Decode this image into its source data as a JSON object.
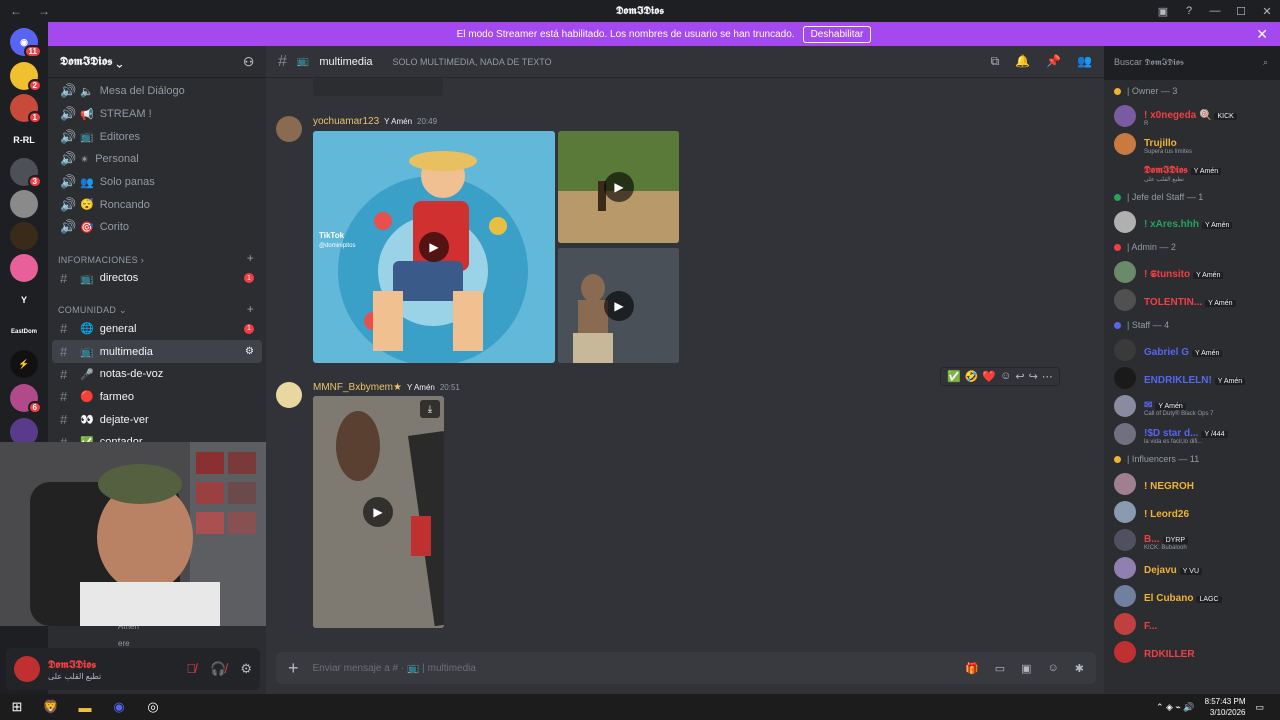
{
  "window": {
    "title": "𝕯𝖔𝖒𝕴𝕯𝖎𝖔𝖘",
    "back": "←",
    "forward": "→"
  },
  "streamer_bar": {
    "message": "El modo Streamer está habilitado. Los nombres de usuario se han truncado.",
    "button": "Deshabilitar",
    "close": "✕"
  },
  "guild_labels": {
    "rrl": "R-RL",
    "eastdom": "EastDom"
  },
  "server": {
    "name": "𝕯𝖔𝖒𝕴𝕯𝖎𝖔𝖘 ⌄",
    "add_user": "⚇"
  },
  "voice_channels": [
    {
      "icon": "🔈",
      "label": "Mesa del Diálogo"
    },
    {
      "icon": "📢",
      "label": "STREAM !"
    },
    {
      "icon": "📺",
      "label": "Editores"
    },
    {
      "icon": "✴",
      "label": "Personal"
    },
    {
      "icon": "👥",
      "label": "Solo panas"
    },
    {
      "icon": "😴",
      "label": "Roncando"
    },
    {
      "icon": "🎯",
      "label": "Corito"
    }
  ],
  "categories": {
    "informaciones": "INFORMACIONES ›",
    "comunidad": "COMUNIDAD ⌄"
  },
  "info_channels": [
    {
      "icon": "📺",
      "label": "directos",
      "unread": true
    }
  ],
  "community_channels": [
    {
      "icon": "🌐",
      "label": "general",
      "unread": true,
      "active": false
    },
    {
      "icon": "📺",
      "label": "multimedia",
      "unread": false,
      "active": true
    },
    {
      "icon": "🎤",
      "label": "notas-de-voz",
      "unread": false,
      "active": false
    },
    {
      "icon": "🔴",
      "label": "farmeo",
      "unread": false,
      "active": false
    },
    {
      "icon": "👀",
      "label": "dejate-ver",
      "unread": false,
      "active": false
    },
    {
      "icon": "✅",
      "label": "contador",
      "unread": false,
      "active": false
    }
  ],
  "voice_users": {
    "user1": "Amén",
    "user2": "ere"
  },
  "user_panel": {
    "name": "𝕯𝖔𝖒𝕴𝕯𝖎𝖔𝖘",
    "status": "تطبع القلب على"
  },
  "channel_header": {
    "name": "multimedia",
    "topic": "SOLO MULTIMEDIA, NADA DE TEXTO"
  },
  "search": {
    "placeholder": "Buscar 𝕯𝖔𝖒𝕴𝕯𝖎𝖔𝖘",
    "icon": "search-icon"
  },
  "messages": [
    {
      "author": "yochuamar123",
      "role": "Y Amén",
      "time": "20:49",
      "color": "#e8c36b",
      "media_text": "TikTok",
      "media_handle": "@dominipitos"
    },
    {
      "author": "MMNF_Bxbymem★",
      "role": "Y Amén",
      "time": "20:51",
      "color": "#e8c36b"
    }
  ],
  "reactions": [
    "✅",
    "🤣",
    "❤️",
    "☺",
    "↩",
    "↪",
    "⋯"
  ],
  "composer": {
    "placeholder": "Enviar mensaje a # · 📺 | multimedia",
    "plus": "+"
  },
  "members": [
    {
      "group": "| Owner — 3",
      "color": "#f0b232",
      "items": [
        {
          "name": "! x0negeda 🍭",
          "tag": "KICK",
          "sub": "R",
          "color": "#f23f43"
        },
        {
          "name": "Trujillo",
          "tag": "",
          "sub": "Supera tus límites",
          "color": "#f0b232"
        },
        {
          "name": "𝕯𝖔𝖒𝕴𝕯𝖎𝖔𝖘",
          "tag": "Y Amén",
          "sub": "تطبع القلب على",
          "color": "#f23f43"
        }
      ]
    },
    {
      "group": "| Jefe del Staff — 1",
      "color": "#23a55a",
      "items": [
        {
          "name": "! xAres.hhh",
          "tag": "Y Amén",
          "sub": "",
          "color": "#23a55a"
        }
      ]
    },
    {
      "group": "| Admin — 2",
      "color": "#f23f43",
      "items": [
        {
          "name": "! 𝕾tunsito",
          "tag": "Y Amén",
          "sub": "",
          "color": "#f23f43"
        },
        {
          "name": "TOLENTIN...",
          "tag": "Y Amén",
          "sub": "",
          "color": "#f23f43"
        }
      ]
    },
    {
      "group": "| Staff — 4",
      "color": "#5865f2",
      "items": [
        {
          "name": "Gabriel G",
          "tag": "Y Amén",
          "sub": "",
          "color": "#5865f2"
        },
        {
          "name": "ENDRIKLELN!",
          "tag": "Y Amén",
          "sub": "",
          "color": "#5865f2"
        },
        {
          "name": "✉",
          "tag": "Y Amén",
          "sub": "Call of Duty® Black Ops 7",
          "color": "#5865f2"
        },
        {
          "name": "!$D star d...",
          "tag": "Y /444",
          "sub": "la vida es facil,lo difi...",
          "color": "#5865f2"
        }
      ]
    },
    {
      "group": "| Influencers — 11",
      "color": "#f0b232",
      "items": [
        {
          "name": "! NEGROH",
          "tag": "",
          "sub": "",
          "color": "#f0b232"
        },
        {
          "name": "! Leord26",
          "tag": "",
          "sub": "",
          "color": "#f0b232"
        },
        {
          "name": "B...",
          "tag": "DYRP",
          "sub": "KICK: Bubalooh",
          "color": "#f23f43"
        },
        {
          "name": "Dejavu",
          "tag": "Y VU",
          "sub": "",
          "color": "#f0b232"
        },
        {
          "name": "El Cubano",
          "tag": "LAGC",
          "sub": "",
          "color": "#f0b232"
        },
        {
          "name": "F...",
          "tag": "",
          "sub": "",
          "color": "#f23f43"
        },
        {
          "name": "RDKILLER",
          "tag": "",
          "sub": "",
          "color": "#f23f43"
        }
      ]
    }
  ],
  "taskbar": {
    "time": "8:57:43 PM",
    "date": "3/10/2026"
  }
}
